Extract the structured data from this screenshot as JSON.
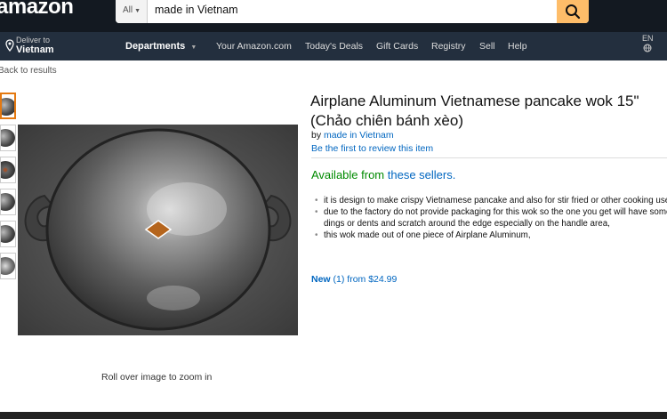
{
  "header": {
    "logo_text": "amazon",
    "search": {
      "category": "All",
      "query": "made in Vietnam"
    },
    "deliver_line1": "Deliver to",
    "deliver_line2": "Vietnam",
    "departments": "Departments",
    "nav": [
      "Your Amazon.com",
      "Today's Deals",
      "Gift Cards",
      "Registry",
      "Sell",
      "Help"
    ],
    "lang": "EN"
  },
  "back_link": "Back to results",
  "image_hint": "Roll over image to zoom in",
  "product": {
    "title_line1": "Airplane Aluminum Vietnamese pancake wok 15\"",
    "title_line2": "(Chảo chiên bánh xèo)",
    "by_prefix": "by",
    "brand": "made in Vietnam",
    "review_link": "Be the first to review this item",
    "availability_prefix": "Available from",
    "availability_link": "these sellers.",
    "bullets": [
      "it is design to make crispy Vietnamese pancake and also for stir fried or other cooking use.",
      "due to the factory do not provide packaging for this wok so the one you get will have some dings or dents and scratch around the edge especially on the handle area,",
      "this wok made out of one piece of Airplane Aluminum,"
    ],
    "offer": {
      "condition": "New",
      "count": "(1)",
      "from": "from $24.99"
    }
  },
  "colors": {
    "topbar": "#131921",
    "navbar": "#232f3e",
    "search_button": "#febd69",
    "link": "#0066c0",
    "available": "#008a00",
    "thumb_selected": "#e47911"
  }
}
